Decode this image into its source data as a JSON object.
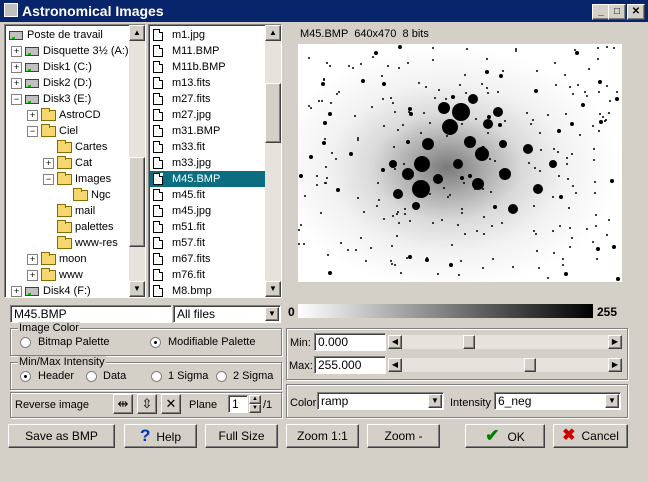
{
  "window": {
    "title": "Astronomical Images",
    "minimize": "_",
    "maximize": "□",
    "close": "✕"
  },
  "tree": [
    {
      "label": "Poste de travail",
      "depth": 0,
      "icon": "computer-icon",
      "expander": ""
    },
    {
      "label": "Disquette 3½ (A:)",
      "depth": 1,
      "icon": "floppy-icon",
      "expander": "+"
    },
    {
      "label": "Disk1 (C:)",
      "depth": 1,
      "icon": "drive-icon",
      "expander": "+"
    },
    {
      "label": "Disk2 (D:)",
      "depth": 1,
      "icon": "drive-icon",
      "expander": "+"
    },
    {
      "label": "Disk3 (E:)",
      "depth": 1,
      "icon": "drive-icon",
      "expander": "−"
    },
    {
      "label": "AstroCD",
      "depth": 2,
      "icon": "folder-icon",
      "expander": "+"
    },
    {
      "label": "Ciel",
      "depth": 2,
      "icon": "folder-icon",
      "expander": "−"
    },
    {
      "label": "Cartes",
      "depth": 3,
      "icon": "folder-icon",
      "expander": ""
    },
    {
      "label": "Cat",
      "depth": 3,
      "icon": "folder-icon",
      "expander": "+"
    },
    {
      "label": "Images",
      "depth": 3,
      "icon": "folder-open-icon",
      "expander": "−"
    },
    {
      "label": "Ngc",
      "depth": 4,
      "icon": "folder-icon",
      "expander": ""
    },
    {
      "label": "mail",
      "depth": 3,
      "icon": "folder-icon",
      "expander": ""
    },
    {
      "label": "palettes",
      "depth": 3,
      "icon": "folder-icon",
      "expander": ""
    },
    {
      "label": "www-res",
      "depth": 3,
      "icon": "folder-icon",
      "expander": ""
    },
    {
      "label": "moon",
      "depth": 2,
      "icon": "folder-icon",
      "expander": "+"
    },
    {
      "label": "www",
      "depth": 2,
      "icon": "folder-icon",
      "expander": "+"
    },
    {
      "label": "Disk4 (F:)",
      "depth": 1,
      "icon": "drive-icon",
      "expander": "+"
    }
  ],
  "files": [
    "m1.jpg",
    "M11.BMP",
    "M11b.BMP",
    "m13.fits",
    "m27.fits",
    "m27.jpg",
    "m31.BMP",
    "m33.fit",
    "m33.jpg",
    "M45.BMP",
    "m45.fit",
    "m45.jpg",
    "m51.fit",
    "m57.fit",
    "m67.fits",
    "m76.fit",
    "M8.bmp"
  ],
  "selected_file_index": 9,
  "filename_value": "M45.BMP",
  "filter_value": "All files",
  "image_info": "M45.BMP  640x470  8 bits",
  "image_color": {
    "legend": "Image Color",
    "bitmap": "Bitmap Palette",
    "modifiable": "Modifiable Palette"
  },
  "minmax": {
    "legend": "Min/Max Intensity",
    "header": "Header",
    "data": "Data",
    "one_sigma": "1 Sigma",
    "two_sigma": "2 Sigma"
  },
  "reverse_image": "Reverse image",
  "plane": {
    "label": "Plane",
    "value": "1",
    "total": "/1"
  },
  "gradient": {
    "min": "0",
    "max": "255"
  },
  "min": {
    "label": "Min:",
    "value": "0.000",
    "fraction": 0.31
  },
  "max": {
    "label": "Max:",
    "value": "255.000",
    "fraction": 0.62
  },
  "color": {
    "label": "Color",
    "value": "ramp"
  },
  "intensity": {
    "label": "Intensity",
    "value": "6_neg"
  },
  "buttons": {
    "save": "Save as BMP",
    "help": "Help",
    "full": "Full Size",
    "zoom1": "Zoom 1:1",
    "zoomminus": "Zoom -",
    "ok": "OK",
    "cancel": "Cancel"
  }
}
